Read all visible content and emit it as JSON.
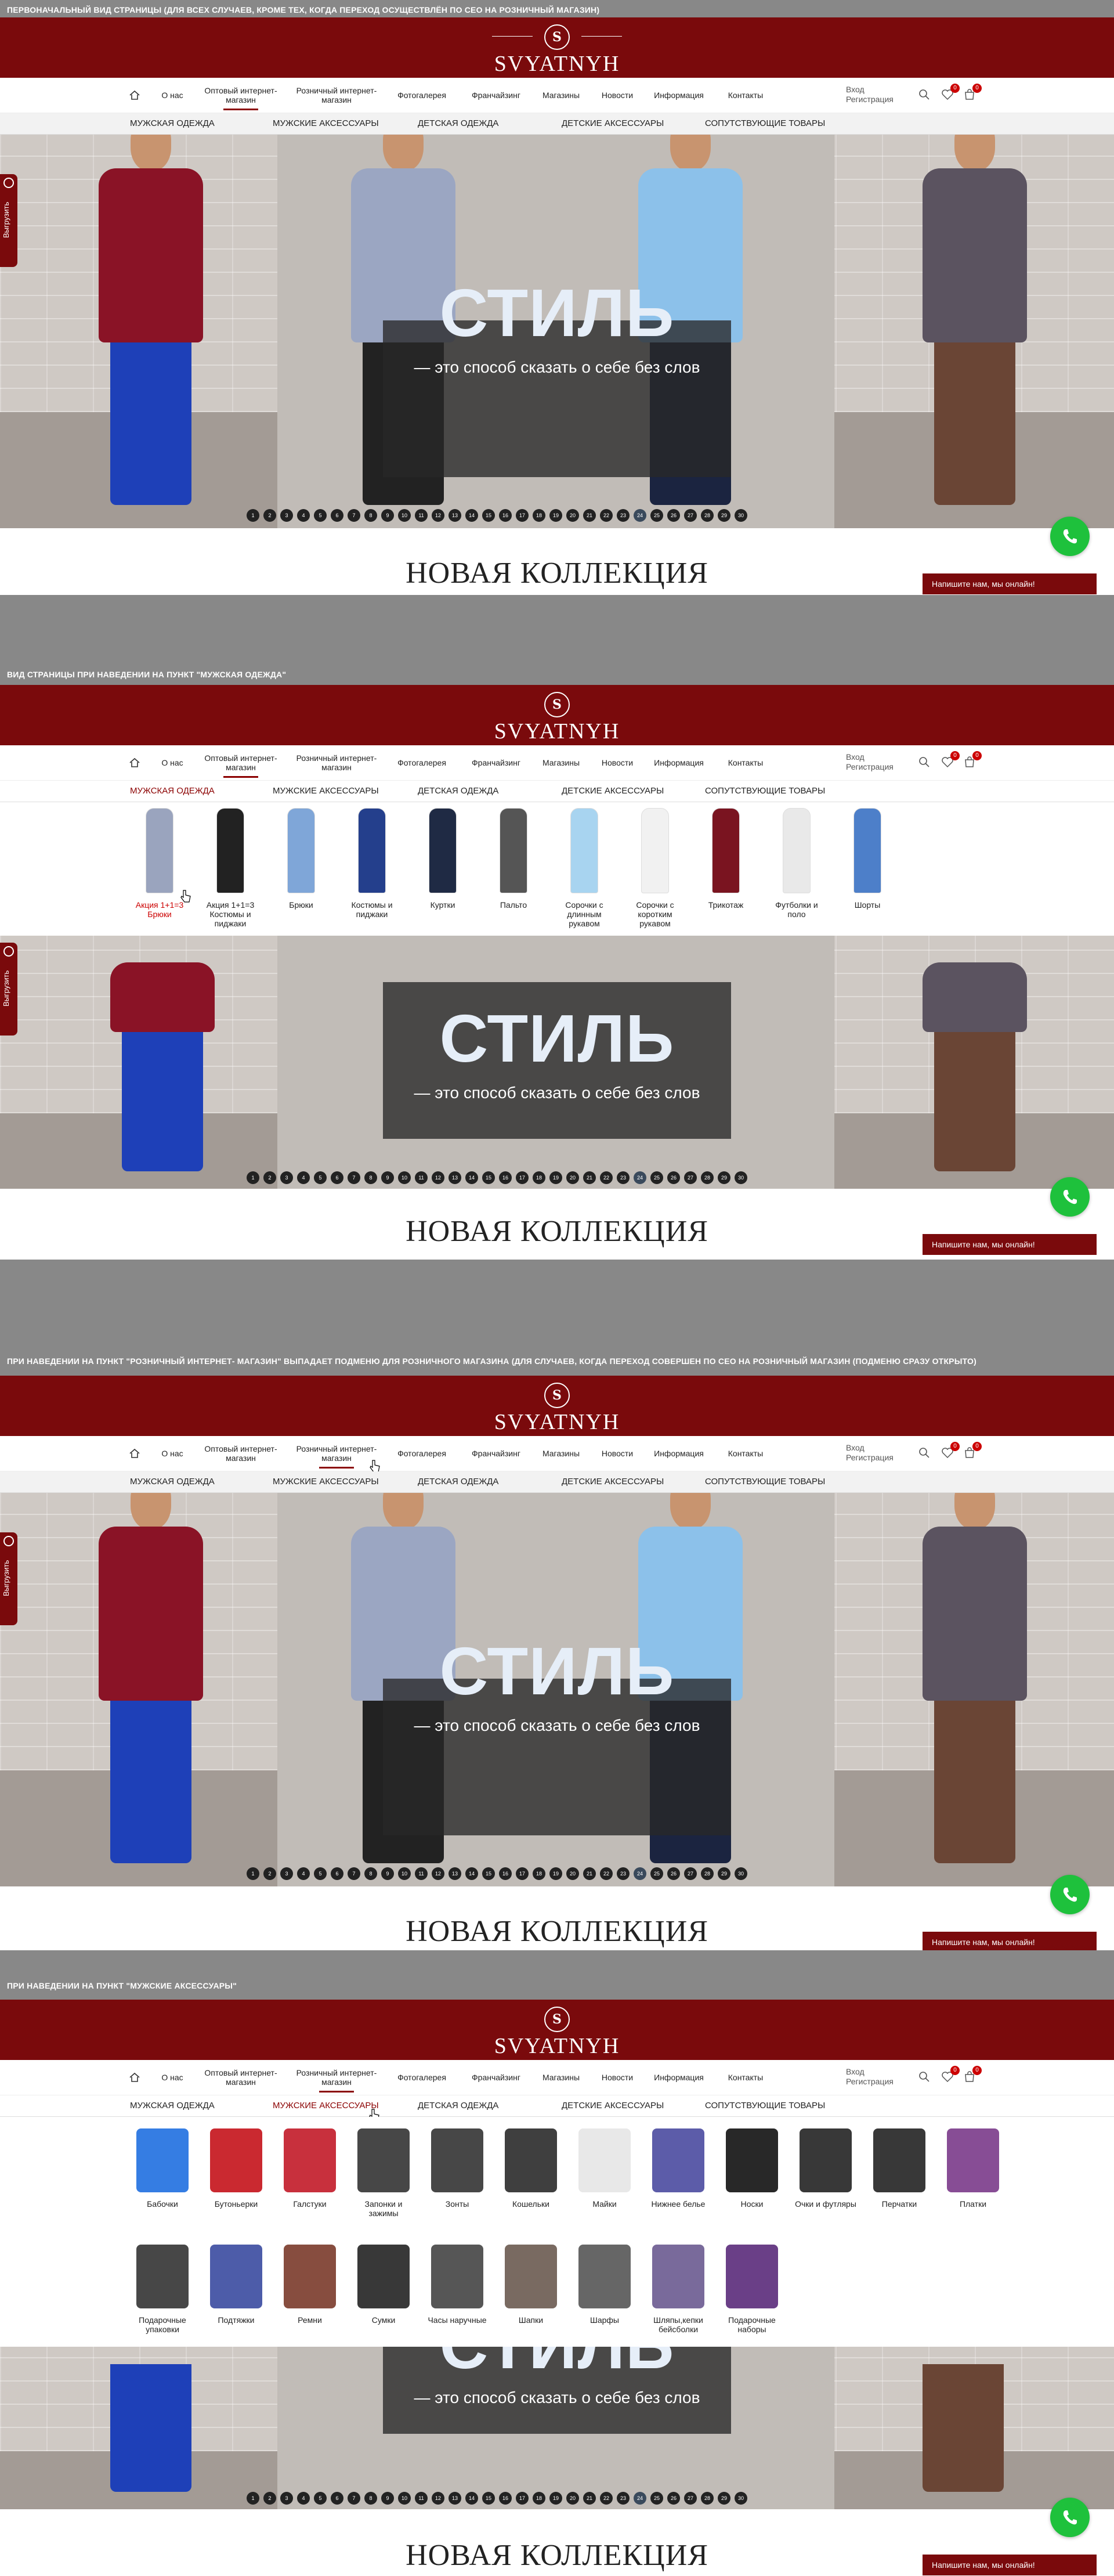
{
  "captions": [
    "ПЕРВОНАЧАЛЬНЫЙ ВИД СТРАНИЦЫ (ДЛЯ ВСЕХ СЛУЧАЕВ, КРОМЕ ТЕХ, КОГДА ПЕРЕХОД ОСУЩЕСТВЛЁН ПО СЕО НА РОЗНИЧНЫЙ МАГАЗИН)",
    "ВИД СТРАНИЦЫ ПРИ НАВЕДЕНИИ НА ПУНКТ \"МУЖСКАЯ ОДЕЖДА\"",
    "ПРИ НАВЕДЕНИИ НА ПУНКТ \"РОЗНИЧНЫЙ ИНТЕРНЕТ- МАГАЗИН\" ВЫПАДАЕТ ПОДМЕНЮ ДЛЯ РОЗНИЧНОГО МАГАЗИНА (ДЛЯ СЛУЧАЕВ, КОГДА ПЕРЕХОД СОВЕРШЕН ПО СЕО НА РОЗНИЧНЫЙ МАГАЗИН (ПОДМЕНЮ СРАЗУ ОТКРЫТО)",
    "ПРИ НАВЕДЕНИИ НА ПУНКТ \"МУЖСКИЕ АКСЕССУАРЫ\""
  ],
  "brand": {
    "logo_mark": "S",
    "name": "SVYATNYH"
  },
  "nav": {
    "wholesale": "Оптовый интернет-магазин",
    "retail": "Розничный интернет-магазин",
    "items": [
      "О нас",
      "Фотогалерея",
      "Франчайзинг",
      "Магазины",
      "Новости",
      "Информация",
      "Контакты"
    ],
    "login": "Вход",
    "register": "Регистрация",
    "wishlist_count": "0",
    "cart_count": "0"
  },
  "categories": [
    "МУЖСКАЯ ОДЕЖДА",
    "МУЖСКИЕ АКСЕССУАРЫ",
    "ДЕТСКАЯ ОДЕЖДА",
    "ДЕТСКИЕ АКСЕССУАРЫ",
    "СОПУТСТВУЮЩИЕ ТОВАРЫ"
  ],
  "side_tab": "Выгрузить",
  "hero": {
    "title": "СТИЛЬ",
    "subtitle": "— это способ сказать о себе без слов",
    "slides": [
      "1",
      "2",
      "3",
      "4",
      "5",
      "6",
      "7",
      "8",
      "9",
      "10",
      "11",
      "12",
      "13",
      "14",
      "15",
      "16",
      "17",
      "18",
      "19",
      "20",
      "21",
      "22",
      "23",
      "24",
      "25",
      "26",
      "27",
      "28",
      "29",
      "30"
    ]
  },
  "collection_title": "НОВАЯ КОЛЛЕКЦИЯ",
  "chat_text": "Напишите нам, мы онлайн!",
  "menu_clothing": [
    "Акция 1+1=3 Брюки",
    "Акция 1+1=3 Костюмы и пиджаки",
    "Брюки",
    "Костюмы и пиджаки",
    "Куртки",
    "Пальто",
    "Сорочки с длинным рукавом",
    "Сорочки с коротким рукавом",
    "Трикотаж",
    "Футболки и поло",
    "Шорты"
  ],
  "menu_accessories": [
    "Бабочки",
    "Бутоньерки",
    "Галстуки",
    "Запонки и зажимы",
    "Зонты",
    "Кошельки",
    "Майки",
    "Нижнее белье",
    "Носки",
    "Очки и футляры",
    "Перчатки",
    "Платки",
    "Подарочные упаковки",
    "Подтяжки",
    "Ремни",
    "Сумки",
    "Часы наручные",
    "Шапки",
    "Шарфы",
    "Шляпы,кепки бейсболки",
    "Подарочные наборы"
  ],
  "colors": {
    "brand_red": "#7a0a0c",
    "whatsapp": "#1ec13c",
    "caption_bg": "#888888"
  }
}
